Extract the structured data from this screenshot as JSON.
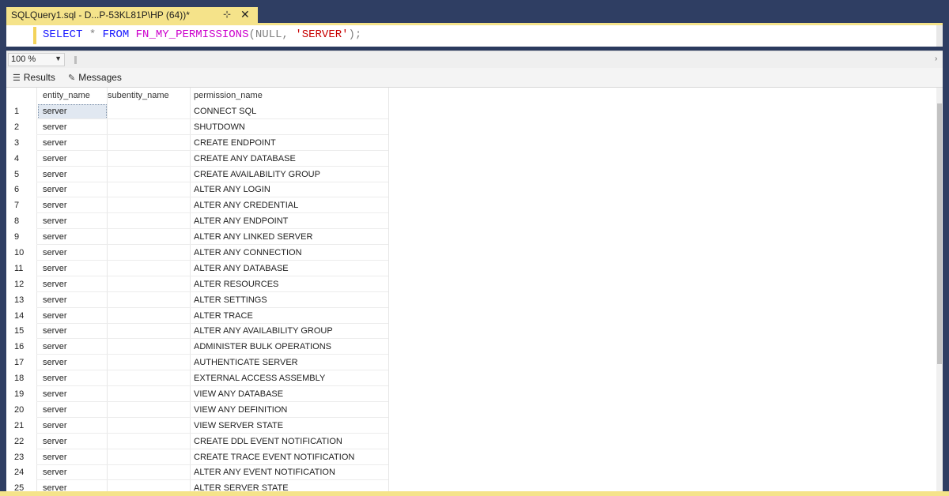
{
  "tab": {
    "title": "SQLQuery1.sql - D...P-53KL81P\\HP (64))*",
    "pin_icon": "pin-icon",
    "close_icon": "close-icon"
  },
  "editor": {
    "keyword_select": "SELECT",
    "op_star": "*",
    "keyword_from": "FROM",
    "function_name": "FN_MY_PERMISSIONS",
    "open_paren": "(",
    "null_arg": "NULL",
    "comma": ",",
    "string_arg": "'SERVER'",
    "close": ");"
  },
  "zoom": {
    "value": "100 %"
  },
  "results": {
    "tab_results": "Results",
    "tab_messages": "Messages",
    "columns": [
      "entity_name",
      "subentity_name",
      "permission_name"
    ],
    "rows": [
      {
        "n": "1",
        "entity": "server",
        "sub": "",
        "perm": "CONNECT SQL"
      },
      {
        "n": "2",
        "entity": "server",
        "sub": "",
        "perm": "SHUTDOWN"
      },
      {
        "n": "3",
        "entity": "server",
        "sub": "",
        "perm": "CREATE ENDPOINT"
      },
      {
        "n": "4",
        "entity": "server",
        "sub": "",
        "perm": "CREATE ANY DATABASE"
      },
      {
        "n": "5",
        "entity": "server",
        "sub": "",
        "perm": "CREATE AVAILABILITY GROUP"
      },
      {
        "n": "6",
        "entity": "server",
        "sub": "",
        "perm": "ALTER ANY LOGIN"
      },
      {
        "n": "7",
        "entity": "server",
        "sub": "",
        "perm": "ALTER ANY CREDENTIAL"
      },
      {
        "n": "8",
        "entity": "server",
        "sub": "",
        "perm": "ALTER ANY ENDPOINT"
      },
      {
        "n": "9",
        "entity": "server",
        "sub": "",
        "perm": "ALTER ANY LINKED SERVER"
      },
      {
        "n": "10",
        "entity": "server",
        "sub": "",
        "perm": "ALTER ANY CONNECTION"
      },
      {
        "n": "11",
        "entity": "server",
        "sub": "",
        "perm": "ALTER ANY DATABASE"
      },
      {
        "n": "12",
        "entity": "server",
        "sub": "",
        "perm": "ALTER RESOURCES"
      },
      {
        "n": "13",
        "entity": "server",
        "sub": "",
        "perm": "ALTER SETTINGS"
      },
      {
        "n": "14",
        "entity": "server",
        "sub": "",
        "perm": "ALTER TRACE"
      },
      {
        "n": "15",
        "entity": "server",
        "sub": "",
        "perm": "ALTER ANY AVAILABILITY GROUP"
      },
      {
        "n": "16",
        "entity": "server",
        "sub": "",
        "perm": "ADMINISTER BULK OPERATIONS"
      },
      {
        "n": "17",
        "entity": "server",
        "sub": "",
        "perm": "AUTHENTICATE SERVER"
      },
      {
        "n": "18",
        "entity": "server",
        "sub": "",
        "perm": "EXTERNAL ACCESS ASSEMBLY"
      },
      {
        "n": "19",
        "entity": "server",
        "sub": "",
        "perm": "VIEW ANY DATABASE"
      },
      {
        "n": "20",
        "entity": "server",
        "sub": "",
        "perm": "VIEW ANY DEFINITION"
      },
      {
        "n": "21",
        "entity": "server",
        "sub": "",
        "perm": "VIEW SERVER STATE"
      },
      {
        "n": "22",
        "entity": "server",
        "sub": "",
        "perm": "CREATE DDL EVENT NOTIFICATION"
      },
      {
        "n": "23",
        "entity": "server",
        "sub": "",
        "perm": "CREATE TRACE EVENT NOTIFICATION"
      },
      {
        "n": "24",
        "entity": "server",
        "sub": "",
        "perm": "ALTER ANY EVENT NOTIFICATION"
      },
      {
        "n": "25",
        "entity": "server",
        "sub": "",
        "perm": "ALTER SERVER STATE"
      }
    ]
  },
  "colors": {
    "tab_accent": "#f5e38a",
    "chrome_background": "#2f3e63",
    "keyword_blue": "#1a1aff",
    "function_magenta": "#cc00cc",
    "string_red": "#c80000"
  }
}
